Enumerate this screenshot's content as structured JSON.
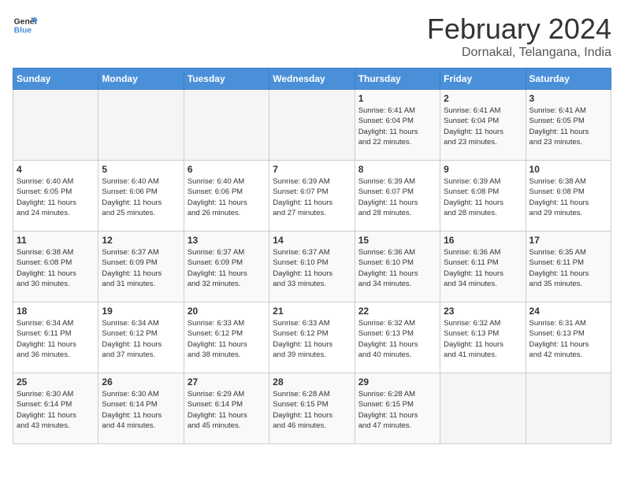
{
  "logo": {
    "line1": "General",
    "line2": "Blue"
  },
  "title": "February 2024",
  "subtitle": "Dornakal, Telangana, India",
  "days_of_week": [
    "Sunday",
    "Monday",
    "Tuesday",
    "Wednesday",
    "Thursday",
    "Friday",
    "Saturday"
  ],
  "weeks": [
    [
      {
        "day": "",
        "info": ""
      },
      {
        "day": "",
        "info": ""
      },
      {
        "day": "",
        "info": ""
      },
      {
        "day": "",
        "info": ""
      },
      {
        "day": "1",
        "info": "Sunrise: 6:41 AM\nSunset: 6:04 PM\nDaylight: 11 hours\nand 22 minutes."
      },
      {
        "day": "2",
        "info": "Sunrise: 6:41 AM\nSunset: 6:04 PM\nDaylight: 11 hours\nand 23 minutes."
      },
      {
        "day": "3",
        "info": "Sunrise: 6:41 AM\nSunset: 6:05 PM\nDaylight: 11 hours\nand 23 minutes."
      }
    ],
    [
      {
        "day": "4",
        "info": "Sunrise: 6:40 AM\nSunset: 6:05 PM\nDaylight: 11 hours\nand 24 minutes."
      },
      {
        "day": "5",
        "info": "Sunrise: 6:40 AM\nSunset: 6:06 PM\nDaylight: 11 hours\nand 25 minutes."
      },
      {
        "day": "6",
        "info": "Sunrise: 6:40 AM\nSunset: 6:06 PM\nDaylight: 11 hours\nand 26 minutes."
      },
      {
        "day": "7",
        "info": "Sunrise: 6:39 AM\nSunset: 6:07 PM\nDaylight: 11 hours\nand 27 minutes."
      },
      {
        "day": "8",
        "info": "Sunrise: 6:39 AM\nSunset: 6:07 PM\nDaylight: 11 hours\nand 28 minutes."
      },
      {
        "day": "9",
        "info": "Sunrise: 6:39 AM\nSunset: 6:08 PM\nDaylight: 11 hours\nand 28 minutes."
      },
      {
        "day": "10",
        "info": "Sunrise: 6:38 AM\nSunset: 6:08 PM\nDaylight: 11 hours\nand 29 minutes."
      }
    ],
    [
      {
        "day": "11",
        "info": "Sunrise: 6:38 AM\nSunset: 6:08 PM\nDaylight: 11 hours\nand 30 minutes."
      },
      {
        "day": "12",
        "info": "Sunrise: 6:37 AM\nSunset: 6:09 PM\nDaylight: 11 hours\nand 31 minutes."
      },
      {
        "day": "13",
        "info": "Sunrise: 6:37 AM\nSunset: 6:09 PM\nDaylight: 11 hours\nand 32 minutes."
      },
      {
        "day": "14",
        "info": "Sunrise: 6:37 AM\nSunset: 6:10 PM\nDaylight: 11 hours\nand 33 minutes."
      },
      {
        "day": "15",
        "info": "Sunrise: 6:36 AM\nSunset: 6:10 PM\nDaylight: 11 hours\nand 34 minutes."
      },
      {
        "day": "16",
        "info": "Sunrise: 6:36 AM\nSunset: 6:11 PM\nDaylight: 11 hours\nand 34 minutes."
      },
      {
        "day": "17",
        "info": "Sunrise: 6:35 AM\nSunset: 6:11 PM\nDaylight: 11 hours\nand 35 minutes."
      }
    ],
    [
      {
        "day": "18",
        "info": "Sunrise: 6:34 AM\nSunset: 6:11 PM\nDaylight: 11 hours\nand 36 minutes."
      },
      {
        "day": "19",
        "info": "Sunrise: 6:34 AM\nSunset: 6:12 PM\nDaylight: 11 hours\nand 37 minutes."
      },
      {
        "day": "20",
        "info": "Sunrise: 6:33 AM\nSunset: 6:12 PM\nDaylight: 11 hours\nand 38 minutes."
      },
      {
        "day": "21",
        "info": "Sunrise: 6:33 AM\nSunset: 6:12 PM\nDaylight: 11 hours\nand 39 minutes."
      },
      {
        "day": "22",
        "info": "Sunrise: 6:32 AM\nSunset: 6:13 PM\nDaylight: 11 hours\nand 40 minutes."
      },
      {
        "day": "23",
        "info": "Sunrise: 6:32 AM\nSunset: 6:13 PM\nDaylight: 11 hours\nand 41 minutes."
      },
      {
        "day": "24",
        "info": "Sunrise: 6:31 AM\nSunset: 6:13 PM\nDaylight: 11 hours\nand 42 minutes."
      }
    ],
    [
      {
        "day": "25",
        "info": "Sunrise: 6:30 AM\nSunset: 6:14 PM\nDaylight: 11 hours\nand 43 minutes."
      },
      {
        "day": "26",
        "info": "Sunrise: 6:30 AM\nSunset: 6:14 PM\nDaylight: 11 hours\nand 44 minutes."
      },
      {
        "day": "27",
        "info": "Sunrise: 6:29 AM\nSunset: 6:14 PM\nDaylight: 11 hours\nand 45 minutes."
      },
      {
        "day": "28",
        "info": "Sunrise: 6:28 AM\nSunset: 6:15 PM\nDaylight: 11 hours\nand 46 minutes."
      },
      {
        "day": "29",
        "info": "Sunrise: 6:28 AM\nSunset: 6:15 PM\nDaylight: 11 hours\nand 47 minutes."
      },
      {
        "day": "",
        "info": ""
      },
      {
        "day": "",
        "info": ""
      }
    ]
  ]
}
